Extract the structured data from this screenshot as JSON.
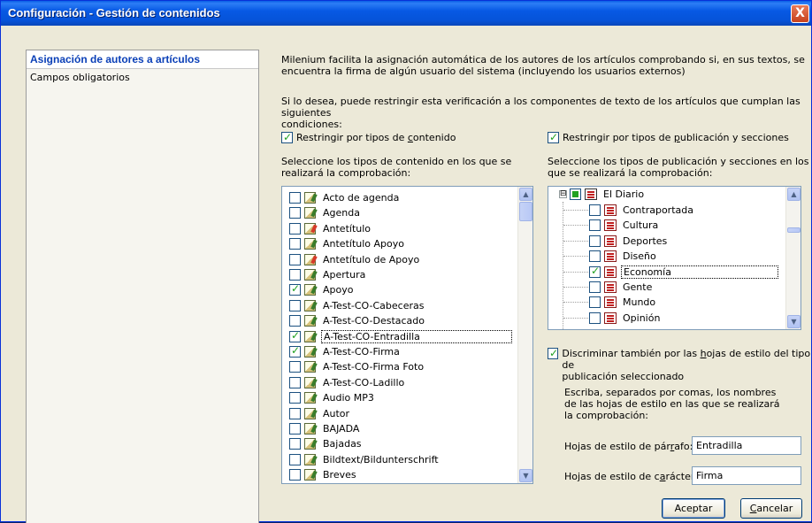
{
  "window": {
    "title": "Configuración - Gestión de contenidos",
    "close_glyph": "X"
  },
  "sidebar": {
    "items": [
      {
        "label": "Asignación de autores a artículos",
        "active": true
      },
      {
        "label": "Campos obligatorios",
        "active": false
      }
    ]
  },
  "main": {
    "intro": [
      "Milenium facilita la asignación automática de los autores de los artículos comprobando si, en sus textos, se",
      "encuentra la firma de algún usuario del sistema (incluyendo los usuarios externos)"
    ],
    "restrict_text": [
      "Si lo desea, puede restringir esta verificación a los componentes de texto de los artículos que cumplan las siguientes",
      "condiciones:"
    ],
    "content_types": {
      "checkbox_label_pre": "Restringir por tipos de ",
      "checkbox_label_u": "c",
      "checkbox_label_post": "ontenido",
      "checked": true,
      "instructions": [
        "Seleccione los tipos de contenido en los que se",
        "realizará la comprobación:"
      ],
      "items": [
        {
          "label": "Acto de agenda",
          "checked": false,
          "icon": "content-type-icon"
        },
        {
          "label": "Agenda",
          "checked": false,
          "icon": "content-type-icon"
        },
        {
          "label": "Antetítulo",
          "checked": false,
          "icon": "content-type-red-icon"
        },
        {
          "label": "Antetítulo Apoyo",
          "checked": false,
          "icon": "content-type-icon"
        },
        {
          "label": "Antetítulo de Apoyo",
          "checked": false,
          "icon": "content-type-red-icon"
        },
        {
          "label": "Apertura",
          "checked": false,
          "icon": "content-type-icon"
        },
        {
          "label": "Apoyo",
          "checked": true,
          "icon": "content-type-icon"
        },
        {
          "label": "A-Test-CO-Cabeceras",
          "checked": false,
          "icon": "content-type-icon"
        },
        {
          "label": "A-Test-CO-Destacado",
          "checked": false,
          "icon": "content-type-icon"
        },
        {
          "label": "A-Test-CO-Entradilla",
          "checked": true,
          "icon": "content-type-icon",
          "selected": true
        },
        {
          "label": "A-Test-CO-Firma",
          "checked": true,
          "icon": "content-type-icon"
        },
        {
          "label": "A-Test-CO-Firma Foto",
          "checked": false,
          "icon": "content-type-icon"
        },
        {
          "label": "A-Test-CO-Ladillo",
          "checked": false,
          "icon": "content-type-icon"
        },
        {
          "label": "Audio MP3",
          "checked": false,
          "icon": "content-type-icon"
        },
        {
          "label": "Autor",
          "checked": false,
          "icon": "content-type-icon"
        },
        {
          "label": "BAJADA",
          "checked": false,
          "icon": "content-type-icon"
        },
        {
          "label": "Bajadas",
          "checked": false,
          "icon": "content-type-icon"
        },
        {
          "label": "Bildtext/Bildunterschrift",
          "checked": false,
          "icon": "content-type-icon"
        },
        {
          "label": "Breves",
          "checked": false,
          "icon": "content-type-icon"
        }
      ]
    },
    "publications": {
      "checkbox_label_pre": "Restringir por tipos de ",
      "checkbox_label_u": "p",
      "checkbox_label_post": "ublicación y secciones",
      "checked": true,
      "instructions": [
        "Seleccione los tipos de publicación y secciones en los",
        "que se realizará la comprobación:"
      ],
      "root": {
        "label": "El Diario",
        "state": "partial",
        "expander": "⊟"
      },
      "sections": [
        {
          "label": "Contraportada",
          "checked": false
        },
        {
          "label": "Cultura",
          "checked": false
        },
        {
          "label": "Deportes",
          "checked": false
        },
        {
          "label": "Diseño",
          "checked": false
        },
        {
          "label": "Economía",
          "checked": true,
          "selected": true
        },
        {
          "label": "Gente",
          "checked": false
        },
        {
          "label": "Mundo",
          "checked": false
        },
        {
          "label": "Opinión",
          "checked": false
        }
      ]
    },
    "styles": {
      "discriminate_pre": "Discriminar también por las ",
      "discriminate_u": "h",
      "discriminate_post": "ojas de estilo del tipo de",
      "discriminate_line2": "publicación seleccionado",
      "discriminate_checked": true,
      "help": [
        "Escriba, separados por comas, los nombres",
        "de las hojas de estilo en las que se realizará",
        "la comprobación:"
      ],
      "paragraph_label_pre": "Hojas de estilo de pár",
      "paragraph_label_u": "r",
      "paragraph_label_post": "afo:",
      "paragraph_value": "Entradilla",
      "character_label_pre": "Hojas de estilo de c",
      "character_label_u": "a",
      "character_label_post": "rácter:",
      "character_value": "Firma"
    }
  },
  "footer": {
    "accept_label": "Aceptar",
    "cancel_u": "C",
    "cancel_rest": "ancelar"
  }
}
